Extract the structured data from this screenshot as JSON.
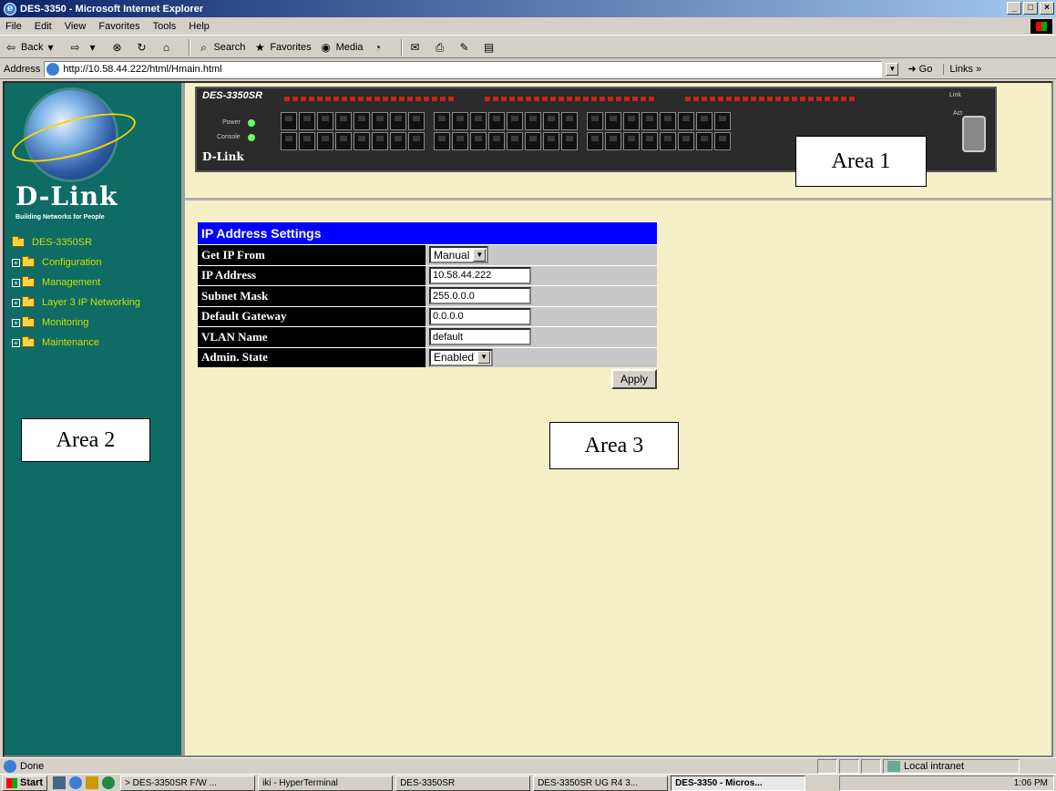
{
  "window": {
    "title": "DES-3350 - Microsoft Internet Explorer"
  },
  "menu": [
    "File",
    "Edit",
    "View",
    "Favorites",
    "Tools",
    "Help"
  ],
  "toolbar": {
    "back": "Back",
    "search": "Search",
    "favorites": "Favorites",
    "media": "Media"
  },
  "address": {
    "label": "Address",
    "url": "http://10.58.44.222/html/Hmain.html",
    "go": "Go",
    "links": "Links"
  },
  "sidebar": {
    "brand": "D-Link",
    "tagline": "Building Networks for People",
    "root": "DES-3350SR",
    "items": [
      "Configuration",
      "Management",
      "Layer 3 IP Networking",
      "Monitoring",
      "Maintenance"
    ]
  },
  "device": {
    "model": "DES-3350SR",
    "brand": "D-Link",
    "power_label": "Power",
    "console_label": "Console",
    "link_label": "Link",
    "act_label": "Act"
  },
  "areas": {
    "area1": "Area 1",
    "area2": "Area 2",
    "area3": "Area 3"
  },
  "settings": {
    "title": "IP Address Settings",
    "rows": [
      {
        "label": "Get IP From",
        "type": "select",
        "value": "Manual"
      },
      {
        "label": "IP Address",
        "type": "text",
        "value": "10.58.44.222"
      },
      {
        "label": "Subnet Mask",
        "type": "text",
        "value": "255.0.0.0"
      },
      {
        "label": "Default Gateway",
        "type": "text",
        "value": "0.0.0.0"
      },
      {
        "label": "VLAN Name",
        "type": "text",
        "value": "default"
      },
      {
        "label": "Admin. State",
        "type": "select",
        "value": "Enabled"
      }
    ],
    "apply": "Apply"
  },
  "status": {
    "text": "Done",
    "zone": "Local intranet"
  },
  "taskbar": {
    "start": "Start",
    "tasks": [
      "> DES-3350SR F/W ...",
      "iki - HyperTerminal",
      "DES-3350SR",
      "DES-3350SR UG R4 3...",
      "DES-3350 - Micros..."
    ],
    "clock": "1:06 PM"
  }
}
